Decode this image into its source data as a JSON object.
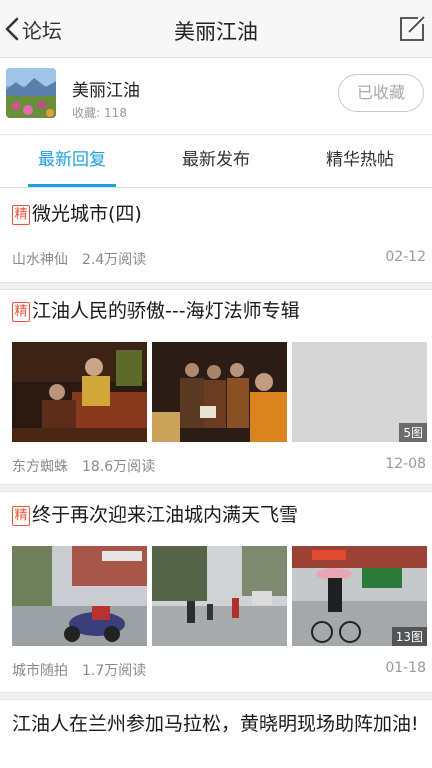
{
  "nav": {
    "back_label": "论坛",
    "title": "美丽江油"
  },
  "forum": {
    "name": "美丽江油",
    "fav_label": "收藏:",
    "fav_count": "118",
    "fav_button": "已收藏"
  },
  "tabs": [
    {
      "label": "最新回复",
      "active": true
    },
    {
      "label": "最新发布",
      "active": false
    },
    {
      "label": "精华热帖",
      "active": false
    }
  ],
  "posts": [
    {
      "badge": "精",
      "title": "微光城市(四)",
      "author": "山水神仙",
      "views": "2.4万阅读",
      "date": "02-12"
    },
    {
      "badge": "精",
      "title": "江油人民的骄傲---海灯法师专辑",
      "author": "东方蜘蛛",
      "views": "18.6万阅读",
      "date": "12-08",
      "image_count": "5图"
    },
    {
      "badge": "精",
      "title": "终于再次迎来江油城内满天飞雪",
      "author": "城市随拍",
      "views": "1.7万阅读",
      "date": "01-18",
      "image_count": "13图"
    },
    {
      "title": "江油人在兰州参加马拉松，黄晓明现场助阵加油!"
    }
  ],
  "colors": {
    "accent": "#1e9ee3",
    "badge": "#e8553c"
  }
}
